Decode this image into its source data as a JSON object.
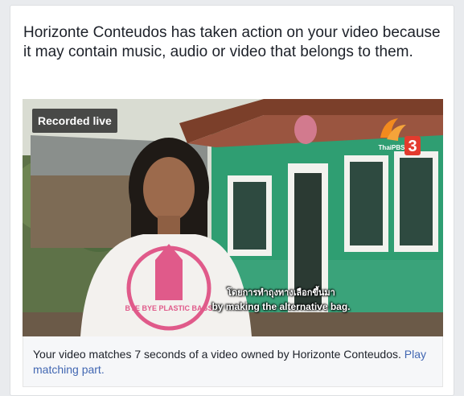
{
  "notice": {
    "headline": "Horizonte Conteudos has taken action on your video because it may contain music, audio or video that belongs to them."
  },
  "video": {
    "badge": "Recorded live",
    "caption_thai": "โดยการทำถุงทางเลือกขึ้นมา",
    "caption_english": "by making the alternative bag.",
    "shirt_text": "BYE BYE PLASTIC BAGS",
    "logo_text": "ThaiPBS",
    "logo_number": "3"
  },
  "footer": {
    "text": "Your video matches 7 seconds of a video owned by Horizonte Conteudos.",
    "link": "Play matching part."
  }
}
